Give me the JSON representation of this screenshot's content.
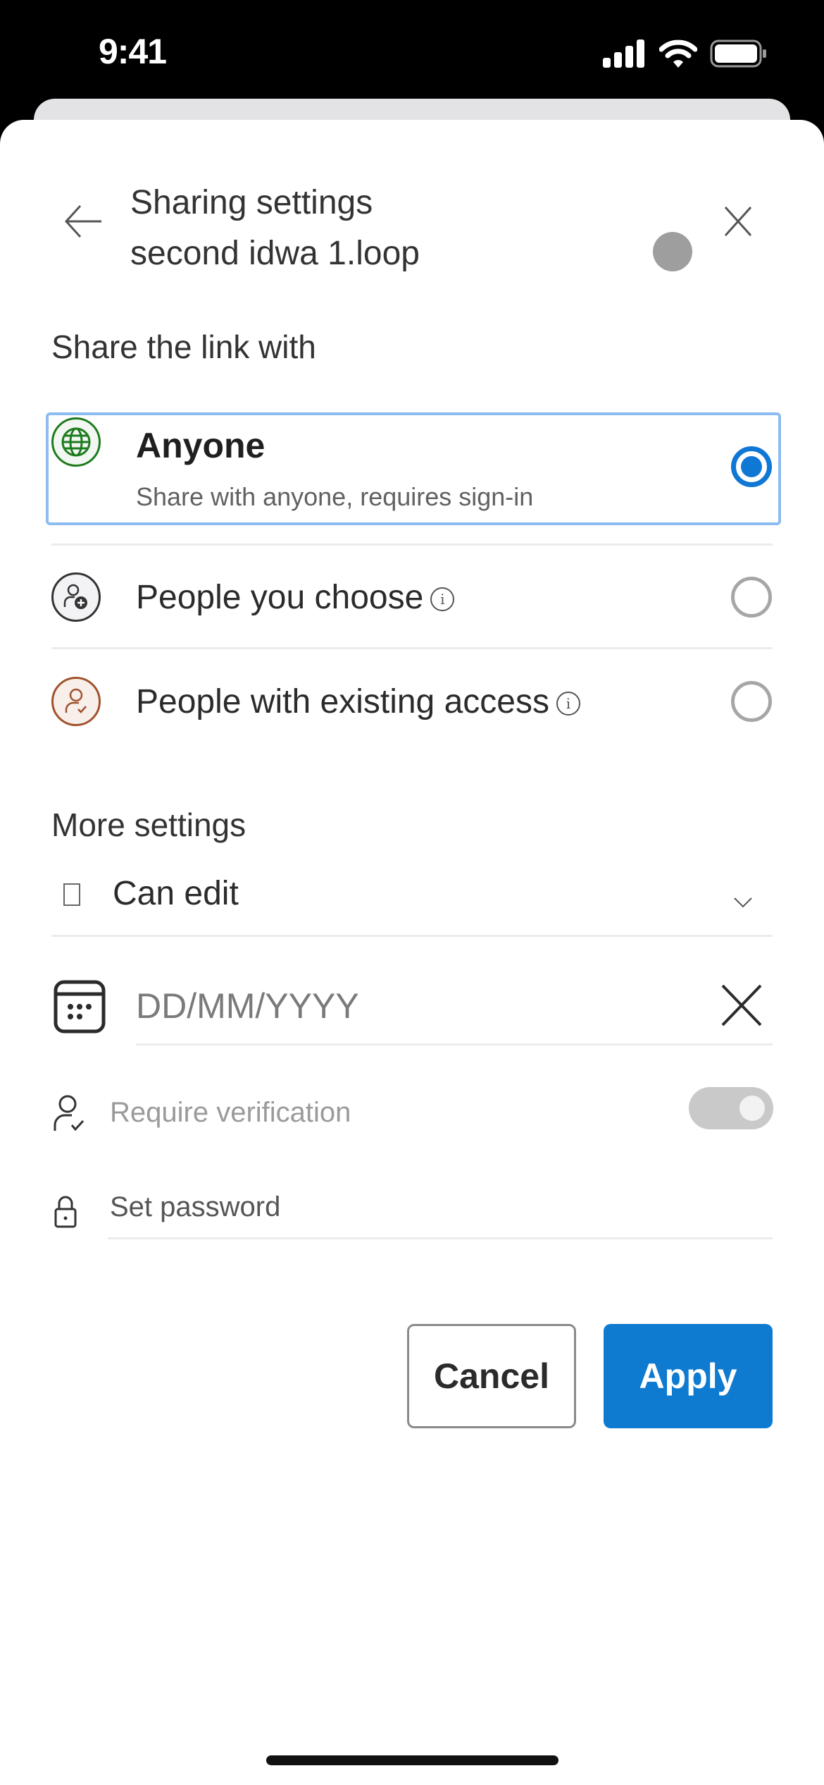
{
  "status_bar": {
    "time": "9:41"
  },
  "header": {
    "title": "Sharing settings",
    "subtitle": "second idwa 1.loop",
    "back_icon": "arrow-left-icon",
    "close_icon": "close-icon"
  },
  "share_section": {
    "title": "Share the link with",
    "options": [
      {
        "label": "Anyone",
        "description": "Share with anyone, requires sign-in",
        "icon": "globe-icon",
        "selected": true
      },
      {
        "label": "People you choose",
        "icon": "person-add-icon",
        "info": "i",
        "selected": false
      },
      {
        "label": "People with existing access",
        "icon": "person-check-icon",
        "info": "i",
        "selected": false
      }
    ]
  },
  "more_settings": {
    "title": "More settings",
    "permission": {
      "value": "Can edit"
    },
    "expiry_date": {
      "placeholder": "DD/MM/YYYY"
    },
    "require_verification": {
      "label": "Require verification",
      "enabled": false
    },
    "password": {
      "placeholder": "Set password"
    }
  },
  "actions": {
    "cancel": "Cancel",
    "apply": "Apply"
  },
  "colors": {
    "accent": "#0f7bd0",
    "selected_border": "#8cbcf0",
    "globe": "#1e7b1e",
    "existing_access": "#a0522d"
  }
}
